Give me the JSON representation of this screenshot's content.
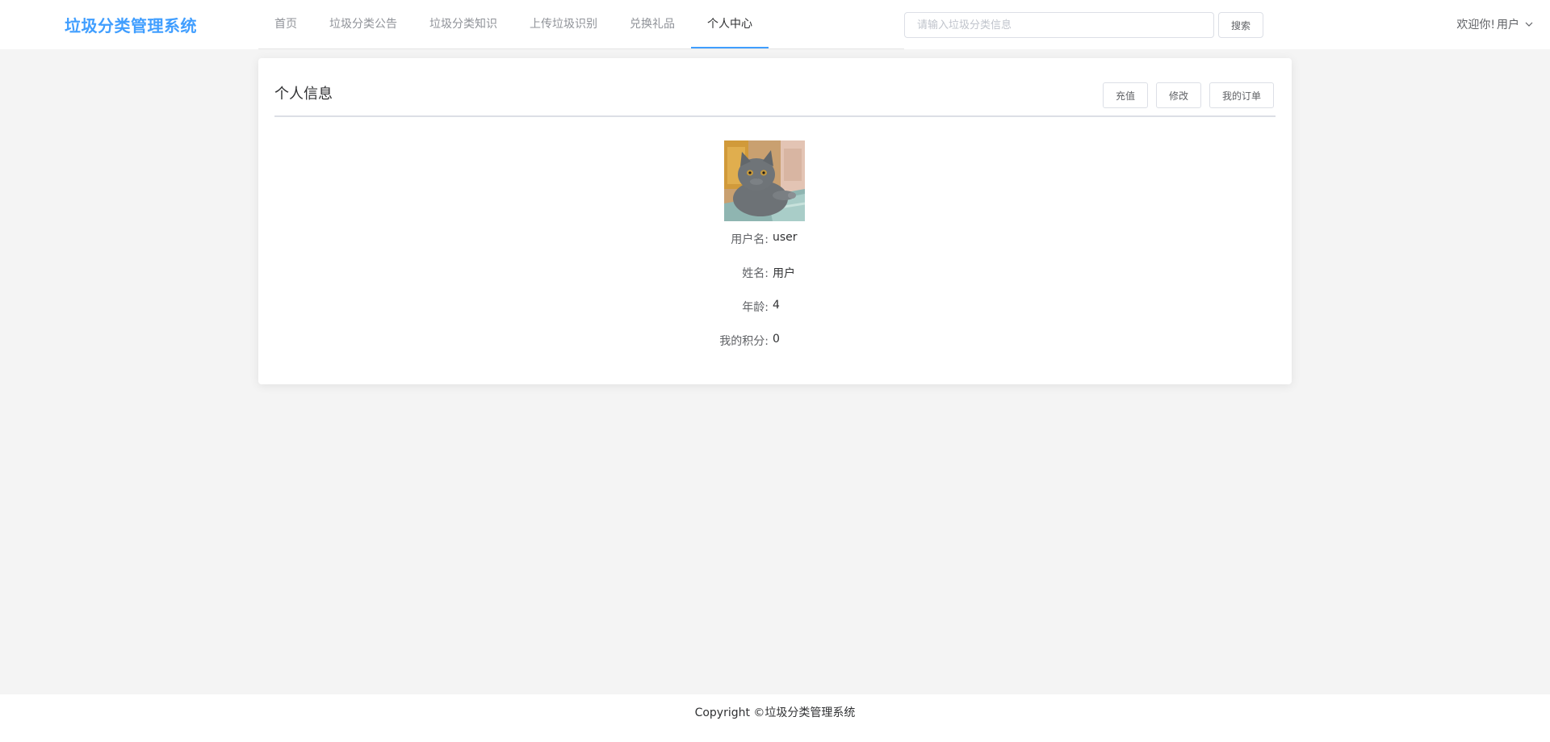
{
  "app": {
    "title": "垃圾分类管理系统",
    "accent_color": "#409eff"
  },
  "nav": {
    "items": [
      {
        "label": "首页",
        "active": false
      },
      {
        "label": "垃圾分类公告",
        "active": false
      },
      {
        "label": "垃圾分类知识",
        "active": false
      },
      {
        "label": "上传垃圾识别",
        "active": false
      },
      {
        "label": "兑换礼品",
        "active": false
      },
      {
        "label": "个人中心",
        "active": true
      }
    ]
  },
  "search": {
    "placeholder": "请输入垃圾分类信息",
    "value": "",
    "button_label": "搜索"
  },
  "user_menu": {
    "welcome": "欢迎你!",
    "username": "用户",
    "icon": "chevron-down-icon"
  },
  "profile": {
    "title": "个人信息",
    "buttons": {
      "recharge": "充值",
      "edit": "修改",
      "orders": "我的订单"
    },
    "avatar_icon": "cat-photo-avatar",
    "fields": [
      {
        "label": "用户名:",
        "value": "user"
      },
      {
        "label": "姓名:",
        "value": "用户"
      },
      {
        "label": "年龄:",
        "value": "4"
      },
      {
        "label": "我的积分:",
        "value": "0"
      }
    ]
  },
  "footer": {
    "copyright": "Copyright ©垃圾分类管理系统"
  }
}
